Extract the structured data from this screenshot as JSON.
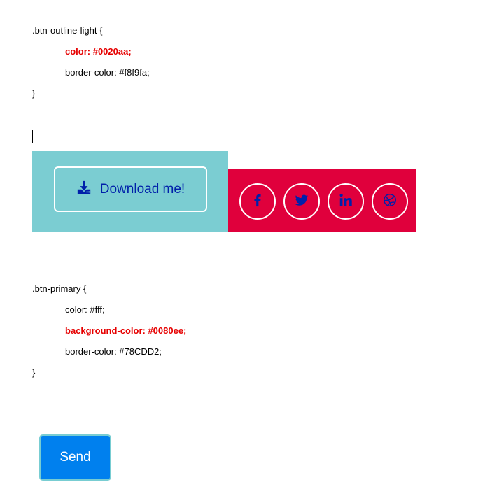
{
  "code_block_1": {
    "selector": ".btn-outline-light {",
    "line_color": "color: #0020aa;",
    "line_border": "border-color: #f8f9fa;",
    "close": "}"
  },
  "download": {
    "label": "Download me!",
    "icon": "download-icon"
  },
  "social": [
    {
      "name": "facebook",
      "icon": "facebook-icon"
    },
    {
      "name": "twitter",
      "icon": "twitter-icon"
    },
    {
      "name": "linkedin",
      "icon": "linkedin-icon"
    },
    {
      "name": "dribbble",
      "icon": "dribbble-icon"
    }
  ],
  "code_block_2": {
    "selector": ".btn-primary {",
    "line_color": "color: #fff;",
    "line_bg": "background-color: #0080ee;",
    "line_border": "border-color: #78CDD2;",
    "close": "}"
  },
  "send": {
    "label": "Send"
  },
  "colors": {
    "teal_panel": "#7bcdd2",
    "red_panel": "#e0003c",
    "icon_blue": "#0020aa",
    "send_bg": "#0080ee",
    "send_border": "#78cdd2",
    "highlight_red": "#e60000"
  }
}
